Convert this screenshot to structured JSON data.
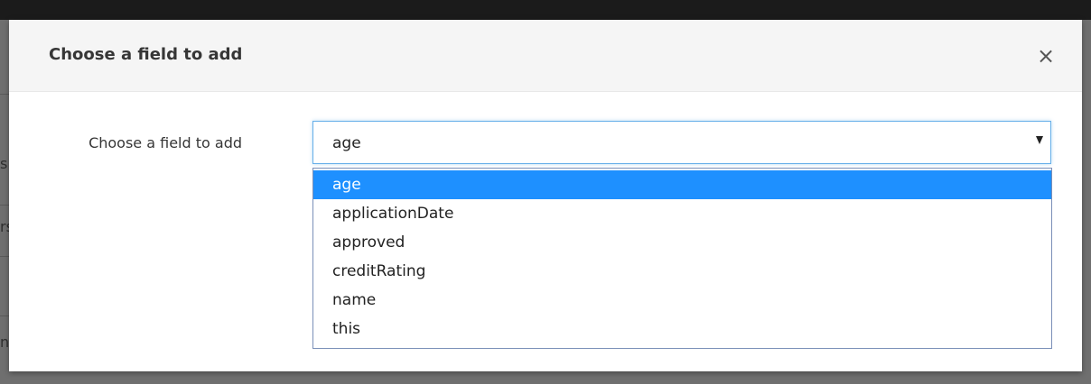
{
  "dialog": {
    "title": "Choose a field to add",
    "close_label": "×",
    "field_label": "Choose a field to add",
    "select": {
      "selected_value": "age",
      "options": [
        {
          "label": "age",
          "highlighted": true
        },
        {
          "label": "applicationDate",
          "highlighted": false
        },
        {
          "label": "approved",
          "highlighted": false
        },
        {
          "label": "creditRating",
          "highlighted": false
        },
        {
          "label": "name",
          "highlighted": false
        },
        {
          "label": "this",
          "highlighted": false
        }
      ]
    }
  },
  "background": {
    "clipped_glyphs": [
      "s",
      "rs",
      "n"
    ]
  },
  "colors": {
    "highlight": "#1e90ff",
    "focus_border": "#66afe9",
    "header_bg": "#f5f5f5",
    "overlay": "#6f6f6f"
  }
}
